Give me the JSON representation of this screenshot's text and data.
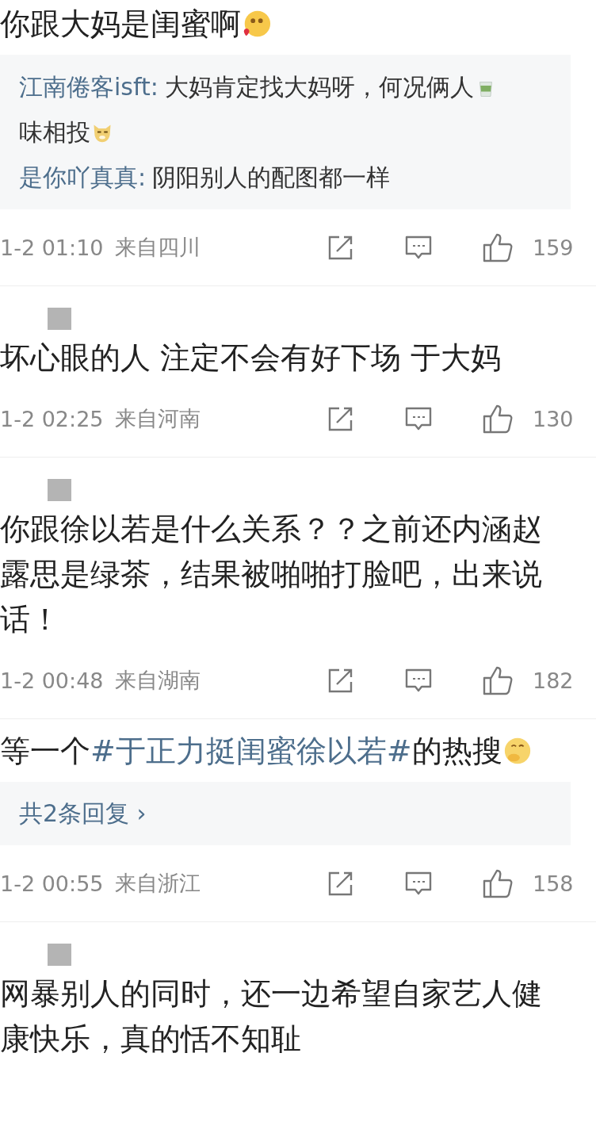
{
  "comments": [
    {
      "author": {
        "kind": "none"
      },
      "body": [
        {
          "kind": "text",
          "text": "你跟大妈是闺蜜啊"
        },
        {
          "kind": "kiss"
        }
      ],
      "replies": {
        "kind": "list",
        "items": [
          {
            "name": "江南倦客isft:",
            "body": [
              {
                "kind": "text",
                "text": "大妈肯定找大妈呀，何况俩人"
              },
              {
                "kind": "tea"
              },
              {
                "kind": "text",
                "text": "味相投"
              },
              {
                "kind": "doge"
              }
            ]
          },
          {
            "name": "是你吖真真:",
            "body": [
              {
                "kind": "text",
                "text": "阴阳别人的配图都一样"
              }
            ]
          }
        ]
      },
      "date": "1-2 01:10",
      "location": "来自四川",
      "likes": "159"
    },
    {
      "author": {
        "kind": "redacted"
      },
      "body": [
        {
          "kind": "text",
          "text": "坏心眼的人 注定不会有好下场 于大妈"
        }
      ],
      "date": "1-2 02:25",
      "location": "来自河南",
      "likes": "130"
    },
    {
      "author": {
        "kind": "redacted"
      },
      "body": [
        {
          "kind": "text",
          "text": "你跟徐以若是什么关系？？之前还内涵赵露思是绿茶，结果被啪啪打脸吧，出来说话！"
        }
      ],
      "date": "1-2 00:48",
      "location": "来自湖南",
      "likes": "182"
    },
    {
      "author": {
        "kind": "none"
      },
      "body": [
        {
          "kind": "text",
          "text": "等一个"
        },
        {
          "kind": "hashtag",
          "text": "#于正力挺闺蜜徐以若#"
        },
        {
          "kind": "text",
          "text": "的热搜"
        },
        {
          "kind": "think"
        }
      ],
      "replies": {
        "kind": "summary",
        "text": "共2条回复 ›"
      },
      "date": "1-2 00:55",
      "location": "来自浙江",
      "likes": "158"
    },
    {
      "author": {
        "kind": "redacted"
      },
      "body": [
        {
          "kind": "text",
          "text": "网暴别人的同时，还一边希望自家艺人健康快乐，真的恬不知耻"
        }
      ]
    }
  ]
}
